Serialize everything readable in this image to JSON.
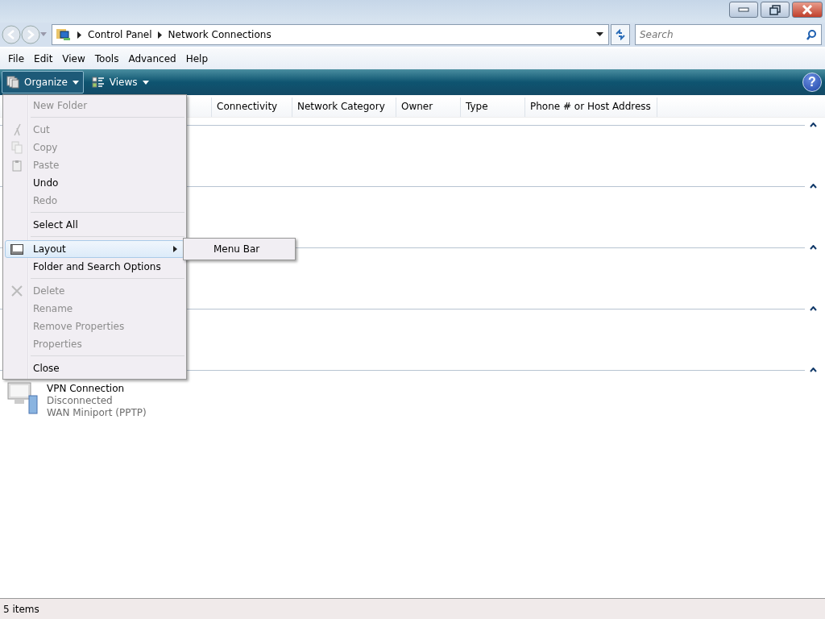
{
  "address_bar": {
    "path": [
      "Control Panel",
      "Network Connections"
    ]
  },
  "search": {
    "placeholder": "Search"
  },
  "menu_bar": [
    "File",
    "Edit",
    "View",
    "Tools",
    "Advanced",
    "Help"
  ],
  "command_bar": [
    {
      "label": "Organize",
      "kind": "organize",
      "pressed": true
    },
    {
      "label": "Views",
      "kind": "views",
      "pressed": false
    }
  ],
  "table": {
    "columns": [
      "Connectivity",
      "Network Category",
      "Owner",
      "Type",
      "Phone # or Host Address"
    ]
  },
  "help_button": {
    "label": "?"
  },
  "groups": [
    {
      "expanded": true
    },
    {
      "expanded": true
    },
    {
      "expanded": true
    },
    {
      "expanded": true
    },
    {
      "expanded": true
    }
  ],
  "items": [
    {
      "name": "VPN Connection",
      "status": "Disconnected",
      "device": "WAN Miniport (PPTP)"
    }
  ],
  "organize_menu": [
    {
      "kind": "item",
      "label": "New Folder",
      "disabled": true
    },
    {
      "kind": "separator"
    },
    {
      "kind": "item",
      "label": "Cut",
      "disabled": true
    },
    {
      "kind": "item",
      "label": "Copy",
      "disabled": true
    },
    {
      "kind": "item",
      "label": "Paste",
      "disabled": true
    },
    {
      "kind": "item",
      "label": "Undo",
      "disabled": false
    },
    {
      "kind": "item",
      "label": "Redo",
      "disabled": true
    },
    {
      "kind": "separator"
    },
    {
      "kind": "item",
      "label": "Select All",
      "disabled": false
    },
    {
      "kind": "separator"
    },
    {
      "kind": "submenu",
      "label": "Layout",
      "disabled": false,
      "selected": true
    },
    {
      "kind": "item",
      "label": "Folder and Search Options",
      "disabled": false
    },
    {
      "kind": "separator"
    },
    {
      "kind": "item",
      "label": "Delete",
      "disabled": true
    },
    {
      "kind": "item",
      "label": "Rename",
      "disabled": true
    },
    {
      "kind": "item",
      "label": "Remove Properties",
      "disabled": true
    },
    {
      "kind": "item",
      "label": "Properties",
      "disabled": true
    },
    {
      "kind": "separator"
    },
    {
      "kind": "item",
      "label": "Close",
      "disabled": false
    }
  ],
  "layout_submenu": [
    "Menu Bar"
  ],
  "status_bar": {
    "text": "5 items"
  }
}
